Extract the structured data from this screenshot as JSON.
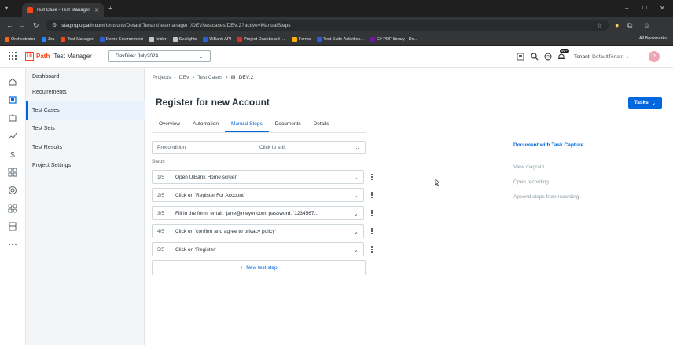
{
  "browser": {
    "tab_title": "Test Case - Test Manager",
    "url_host": "staging.uipath.com",
    "url_path": "/testsuite/DefaultTenant/testmanager_/DEV/testcases/DEV:2?active=ManualSteps",
    "bookmarks": [
      "Orchestrator",
      "Jira",
      "Test Manager",
      "Demo Environment",
      "folder",
      "Sealights",
      "UiBank API",
      "Project Dashboard -...",
      "Forms",
      "Test Suite Activities...",
      "C# PDF library - Do..."
    ],
    "bookmark_colors": [
      "#f26722",
      "#2684ff",
      "#fa4616",
      "#2c5fd4",
      "#c4c7c5",
      "#c4c7c5",
      "#2c5fd4",
      "#d93025",
      "#ffb300",
      "#2c5fd4",
      "#6a1b9a"
    ],
    "all_bookmarks": "All Bookmarks"
  },
  "header": {
    "logo_box": "Ui",
    "logo_path": "Path",
    "product": "Test Manager",
    "project": "DevDive: July2024",
    "notification_badge": "99+",
    "tenant_label": "Tenant:",
    "tenant_value": "DefaultTenant",
    "avatar_initials": "TB"
  },
  "nav": {
    "items": [
      "Dashboard",
      "Requirements",
      "Test Cases",
      "Test Sets",
      "Test Results",
      "Project Settings"
    ],
    "active": "Test Cases"
  },
  "breadcrumb": {
    "projects": "Projects",
    "dev": "DEV",
    "test_cases": "Test Cases",
    "current": "DEV:2"
  },
  "page": {
    "title": "Register for new Account",
    "tasks_button": "Tasks",
    "tabs": [
      "Overview",
      "Automation",
      "Manual Steps",
      "Documents",
      "Details"
    ],
    "active_tab": "Manual Steps",
    "precondition_label": "Precondition",
    "precondition_action": "Click to edit",
    "steps_label": "Steps",
    "steps": [
      {
        "num": "1/5",
        "text": "Open UiBank Home screen"
      },
      {
        "num": "2/5",
        "text": "Click on 'Register For Account'"
      },
      {
        "num": "3/5",
        "text": "Fill in the form: email: 'jane@meyer.com' password: '1234567..."
      },
      {
        "num": "4/5",
        "text": "Click on 'confirm and agree to privacy policy'"
      },
      {
        "num": "5/5",
        "text": "Click on 'Register'"
      }
    ],
    "new_step": "New test step"
  },
  "side_actions": {
    "document_capture": "Document with Task Capture",
    "view_diagram": "View diagram",
    "open_recording": "Open recording",
    "append_steps": "Append steps from recording"
  },
  "colors": {
    "accent": "#0067df",
    "brand": "#fa4616"
  }
}
